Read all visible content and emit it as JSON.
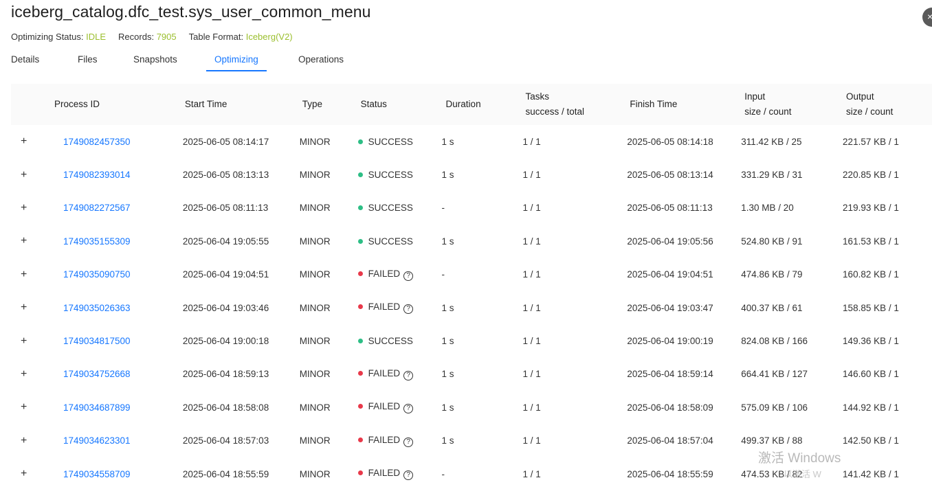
{
  "header": {
    "title": "iceberg_catalog.dfc_test.sys_user_common_menu",
    "meta": [
      {
        "label": "Optimizing Status:",
        "value": "IDLE"
      },
      {
        "label": "Records:",
        "value": "7905"
      },
      {
        "label": "Table Format:",
        "value": "Iceberg(V2)"
      }
    ]
  },
  "tabs": [
    "Details",
    "Files",
    "Snapshots",
    "Optimizing",
    "Operations"
  ],
  "active_tab": "Optimizing",
  "columns": {
    "process_id": "Process ID",
    "start_time": "Start Time",
    "type": "Type",
    "status": "Status",
    "duration": "Duration",
    "tasks_l1": "Tasks",
    "tasks_l2": "success / total",
    "finish_time": "Finish Time",
    "input_l1": "Input",
    "input_l2": "size / count",
    "output_l1": "Output",
    "output_l2": "size / count"
  },
  "expand_symbol": "+",
  "help_symbol": "?",
  "rows": [
    {
      "pid": "1749082457350",
      "start": "2025-06-05 08:14:17",
      "type": "MINOR",
      "status": "SUCCESS",
      "help": false,
      "duration": "1 s",
      "tasks": "1 / 1",
      "finish": "2025-06-05 08:14:18",
      "input": "311.42 KB / 25",
      "output": "221.57 KB / 1"
    },
    {
      "pid": "1749082393014",
      "start": "2025-06-05 08:13:13",
      "type": "MINOR",
      "status": "SUCCESS",
      "help": false,
      "duration": "1 s",
      "tasks": "1 / 1",
      "finish": "2025-06-05 08:13:14",
      "input": "331.29 KB / 31",
      "output": "220.85 KB / 1"
    },
    {
      "pid": "1749082272567",
      "start": "2025-06-05 08:11:13",
      "type": "MINOR",
      "status": "SUCCESS",
      "help": false,
      "duration": "-",
      "tasks": "1 / 1",
      "finish": "2025-06-05 08:11:13",
      "input": "1.30 MB / 20",
      "output": "219.93 KB / 1"
    },
    {
      "pid": "1749035155309",
      "start": "2025-06-04 19:05:55",
      "type": "MINOR",
      "status": "SUCCESS",
      "help": false,
      "duration": "1 s",
      "tasks": "1 / 1",
      "finish": "2025-06-04 19:05:56",
      "input": "524.80 KB / 91",
      "output": "161.53 KB / 1"
    },
    {
      "pid": "1749035090750",
      "start": "2025-06-04 19:04:51",
      "type": "MINOR",
      "status": "FAILED",
      "help": true,
      "duration": "-",
      "tasks": "1 / 1",
      "finish": "2025-06-04 19:04:51",
      "input": "474.86 KB / 79",
      "output": "160.82 KB / 1"
    },
    {
      "pid": "1749035026363",
      "start": "2025-06-04 19:03:46",
      "type": "MINOR",
      "status": "FAILED",
      "help": true,
      "duration": "1 s",
      "tasks": "1 / 1",
      "finish": "2025-06-04 19:03:47",
      "input": "400.37 KB / 61",
      "output": "158.85 KB / 1"
    },
    {
      "pid": "1749034817500",
      "start": "2025-06-04 19:00:18",
      "type": "MINOR",
      "status": "SUCCESS",
      "help": false,
      "duration": "1 s",
      "tasks": "1 / 1",
      "finish": "2025-06-04 19:00:19",
      "input": "824.08 KB / 166",
      "output": "149.36 KB / 1"
    },
    {
      "pid": "1749034752668",
      "start": "2025-06-04 18:59:13",
      "type": "MINOR",
      "status": "FAILED",
      "help": true,
      "duration": "1 s",
      "tasks": "1 / 1",
      "finish": "2025-06-04 18:59:14",
      "input": "664.41 KB / 127",
      "output": "146.60 KB / 1"
    },
    {
      "pid": "1749034687899",
      "start": "2025-06-04 18:58:08",
      "type": "MINOR",
      "status": "FAILED",
      "help": true,
      "duration": "1 s",
      "tasks": "1 / 1",
      "finish": "2025-06-04 18:58:09",
      "input": "575.09 KB / 106",
      "output": "144.92 KB / 1"
    },
    {
      "pid": "1749034623301",
      "start": "2025-06-04 18:57:03",
      "type": "MINOR",
      "status": "FAILED",
      "help": true,
      "duration": "1 s",
      "tasks": "1 / 1",
      "finish": "2025-06-04 18:57:04",
      "input": "499.37 KB / 88",
      "output": "142.50 KB / 1"
    },
    {
      "pid": "1749034558709",
      "start": "2025-06-04 18:55:59",
      "type": "MINOR",
      "status": "FAILED",
      "help": true,
      "duration": "-",
      "tasks": "1 / 1",
      "finish": "2025-06-04 18:55:59",
      "input": "474.53 KB / 82",
      "output": "141.42 KB / 1"
    }
  ],
  "overlay": {
    "windows_title": "激活 Windows",
    "windows_sub": "以激活 W"
  },
  "colors": {
    "accent": "#1677ff",
    "success": "#2dbe85",
    "failed": "#e8394a",
    "meta_value": "#9bbf2e"
  }
}
